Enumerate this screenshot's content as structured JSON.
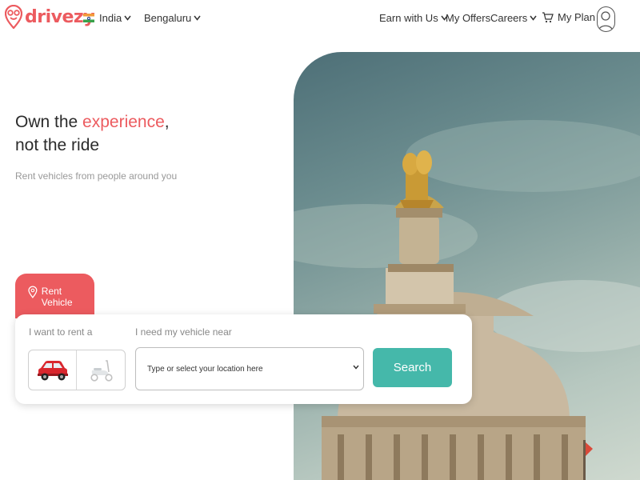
{
  "brand": {
    "name": "drivezy",
    "color": "#ec5b5f"
  },
  "header": {
    "country": "India",
    "city": "Bengaluru",
    "nav": {
      "earn": "Earn with Us",
      "offers": "My Offers",
      "careers": "Careers",
      "plan": "My Plan"
    },
    "icons": {
      "flag": "india-flag-icon",
      "cart": "cart-icon",
      "profile": "profile-icon",
      "chevron": "chevron-down-icon"
    }
  },
  "hero": {
    "headline_part1": "Own the ",
    "headline_accent": "experience",
    "headline_part2": ",",
    "headline_line2": "not the ride",
    "subtitle": "Rent vehicles from people around you",
    "image": "vidhana-soudha-photo"
  },
  "booking": {
    "tab_label": "Rent Vehicle",
    "want_label": "I want to rent a",
    "vehicle_options": [
      "car",
      "scooter"
    ],
    "selected_vehicle": "car",
    "near_label": "I need my vehicle near",
    "location_placeholder": "Type or select your location here",
    "search_label": "Search",
    "search_color": "#45b8aa"
  }
}
